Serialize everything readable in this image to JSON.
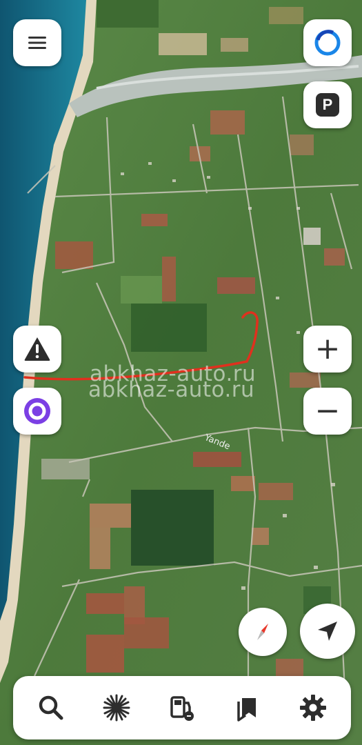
{
  "map": {
    "watermark": "abkhaz-auto.ru",
    "road_label": "Yande",
    "route_color": "#e0301e"
  },
  "controls": {
    "menu_icon": "menu-icon",
    "assistant_top_icon": "alice-circle-icon",
    "parking_icon": "parking-icon",
    "parking_letter": "P",
    "warning_icon": "road-alert-icon",
    "alice_icon": "alice-assistant-icon",
    "zoom_in_label": "+",
    "zoom_out_label": "−",
    "compass_icon": "compass-icon",
    "my_location_icon": "navigation-arrow-icon"
  },
  "bottom_bar": {
    "items": [
      {
        "name": "search",
        "icon": "search-icon"
      },
      {
        "name": "discovery",
        "icon": "sparkle-icon"
      },
      {
        "name": "fuel",
        "icon": "fuel-pump-icon"
      },
      {
        "name": "bookmarks",
        "icon": "bookmarks-icon"
      },
      {
        "name": "settings",
        "icon": "gear-icon"
      }
    ]
  },
  "colors": {
    "sea": "#1b6e86",
    "beach": "#e6dcc4",
    "vegetation": "#4f7a3e",
    "accent_blue": "#2a78e4",
    "alice_purple": "#7b3fe4"
  }
}
